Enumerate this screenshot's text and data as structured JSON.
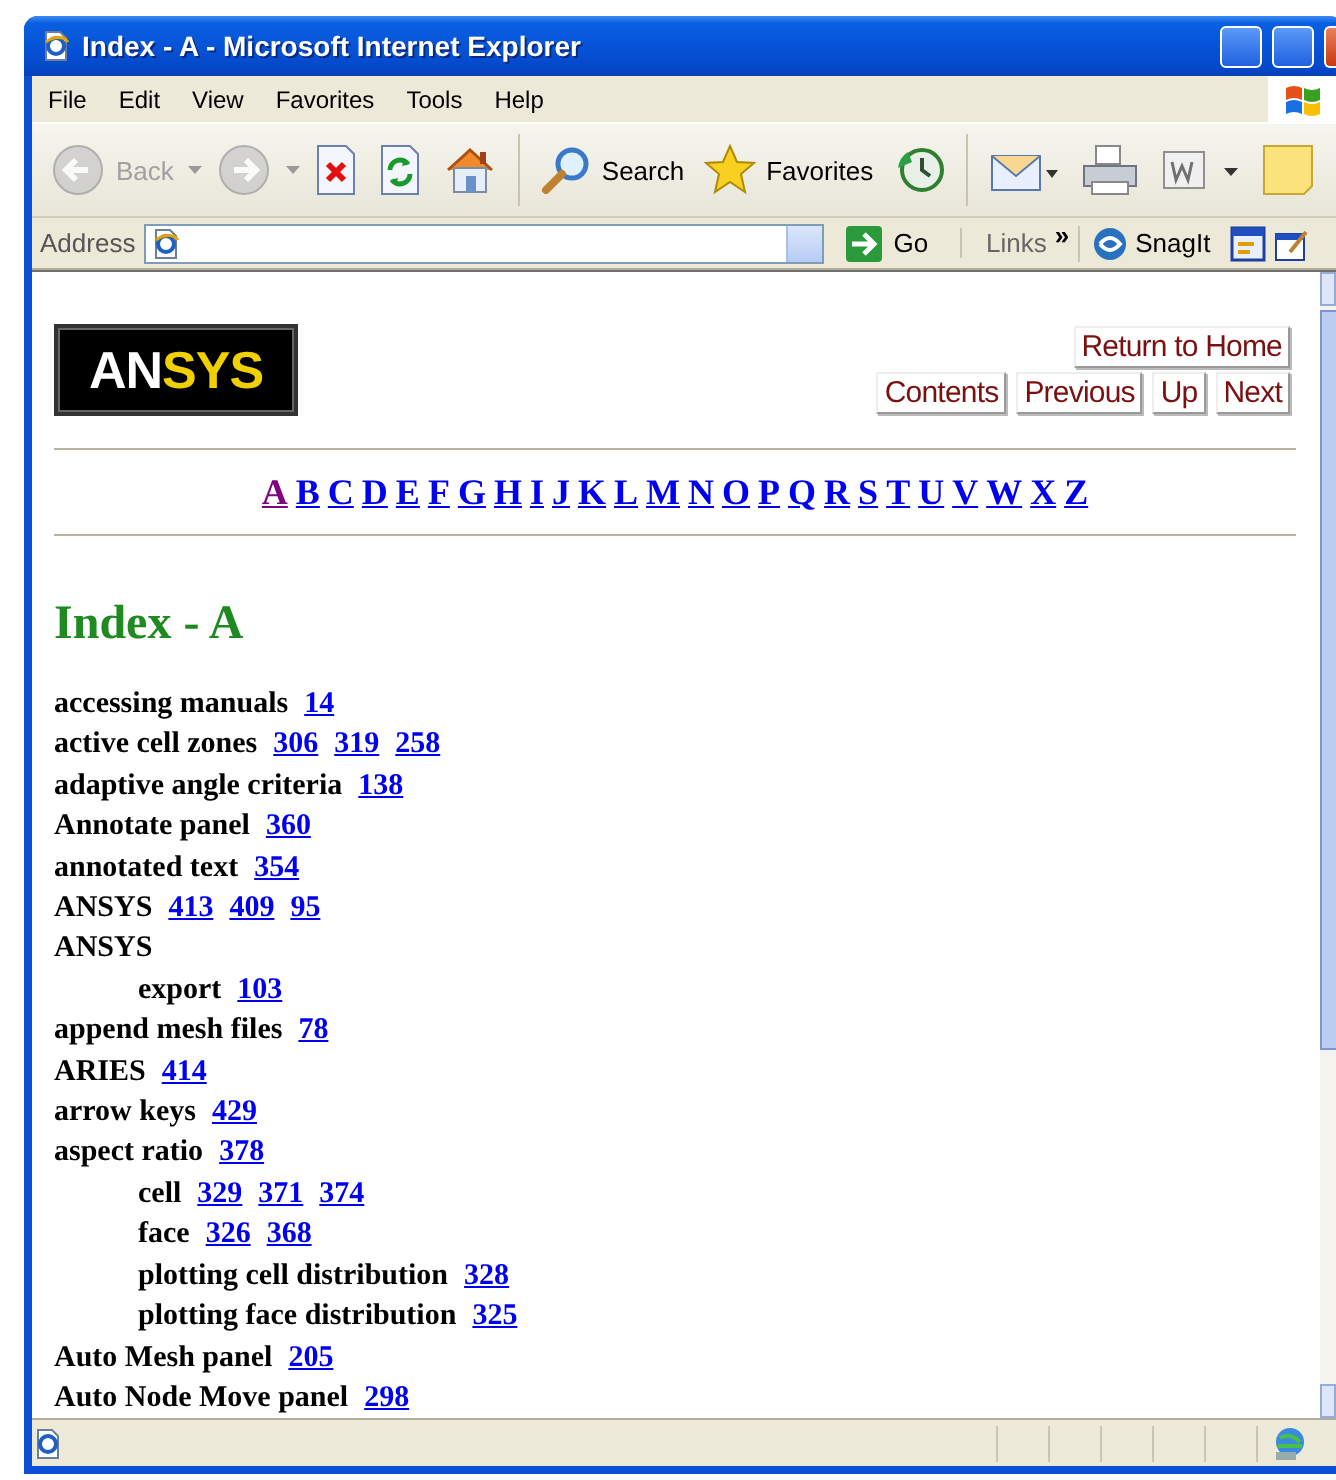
{
  "window": {
    "title": "Index - A - Microsoft Internet Explorer"
  },
  "menu": [
    "File",
    "Edit",
    "View",
    "Favorites",
    "Tools",
    "Help"
  ],
  "toolbar": [
    {
      "kind": "back",
      "label": "Back",
      "disabled": true
    },
    {
      "kind": "forward",
      "disabled": true
    },
    {
      "kind": "stop"
    },
    {
      "kind": "refresh"
    },
    {
      "kind": "home"
    },
    {
      "kind": "search",
      "label": "Search"
    },
    {
      "kind": "favorites",
      "label": "Favorites"
    },
    {
      "kind": "history"
    },
    {
      "kind": "mail"
    },
    {
      "kind": "print"
    },
    {
      "kind": "edit"
    },
    {
      "kind": "note"
    }
  ],
  "address_bar": {
    "label": "Address",
    "go": "Go",
    "links": "Links",
    "chevron": "»",
    "snagit": "SnagIt"
  },
  "page": {
    "logo": [
      "AN",
      "SYS"
    ],
    "home_button": "Return to Home",
    "nav_buttons": [
      "Contents",
      "Previous",
      "Up",
      "Next"
    ],
    "letters": [
      {
        "text": "A",
        "visited": true
      },
      {
        "text": "B",
        "visited": false
      },
      {
        "text": "C",
        "visited": false
      },
      {
        "text": "D",
        "visited": false
      },
      {
        "text": "E",
        "visited": false
      },
      {
        "text": "F",
        "visited": false
      },
      {
        "text": "G",
        "visited": false
      },
      {
        "text": "H",
        "visited": false
      },
      {
        "text": "I",
        "visited": false
      },
      {
        "text": "J",
        "visited": false
      },
      {
        "text": "K",
        "visited": false
      },
      {
        "text": "L",
        "visited": false
      },
      {
        "text": "M",
        "visited": false
      },
      {
        "text": "N",
        "visited": false
      },
      {
        "text": "O",
        "visited": false
      },
      {
        "text": "P",
        "visited": false
      },
      {
        "text": "Q",
        "visited": false
      },
      {
        "text": "R",
        "visited": false
      },
      {
        "text": "S",
        "visited": false
      },
      {
        "text": "T",
        "visited": false
      },
      {
        "text": "U",
        "visited": false
      },
      {
        "text": "V",
        "visited": false
      },
      {
        "text": "W",
        "visited": false
      },
      {
        "text": "X",
        "visited": false
      },
      {
        "text": "Z",
        "visited": false
      }
    ],
    "heading": "Index - A",
    "entries": [
      {
        "term": "accessing manuals",
        "pages": [
          "14"
        ]
      },
      {
        "term": "active cell zones",
        "pages": [
          "306",
          "319",
          "258"
        ]
      },
      {
        "term": "adaptive angle criteria",
        "pages": [
          "138"
        ]
      },
      {
        "term": "Annotate panel",
        "pages": [
          "360"
        ]
      },
      {
        "term": "annotated text",
        "pages": [
          "354"
        ]
      },
      {
        "term": "ANSYS",
        "pages": [
          "413",
          "409",
          "95"
        ]
      },
      {
        "term": "ANSYS",
        "children": [
          {
            "term": "export",
            "pages": [
              "103"
            ]
          }
        ]
      },
      {
        "term": "append mesh files",
        "pages": [
          "78"
        ]
      },
      {
        "term": "ARIES",
        "pages": [
          "414"
        ]
      },
      {
        "term": "arrow keys",
        "pages": [
          "429"
        ]
      },
      {
        "term": "aspect ratio",
        "pages": [
          "378"
        ],
        "children": [
          {
            "term": "cell",
            "pages": [
              "329",
              "371",
              "374"
            ]
          },
          {
            "term": "face",
            "pages": [
              "326",
              "368"
            ]
          },
          {
            "term": "plotting cell distribution",
            "pages": [
              "328"
            ]
          },
          {
            "term": "plotting face distribution",
            "pages": [
              "325"
            ]
          }
        ]
      },
      {
        "term": "Auto Mesh panel",
        "pages": [
          "205"
        ]
      },
      {
        "term": "Auto Node Move panel",
        "pages": [
          "298"
        ]
      }
    ]
  }
}
